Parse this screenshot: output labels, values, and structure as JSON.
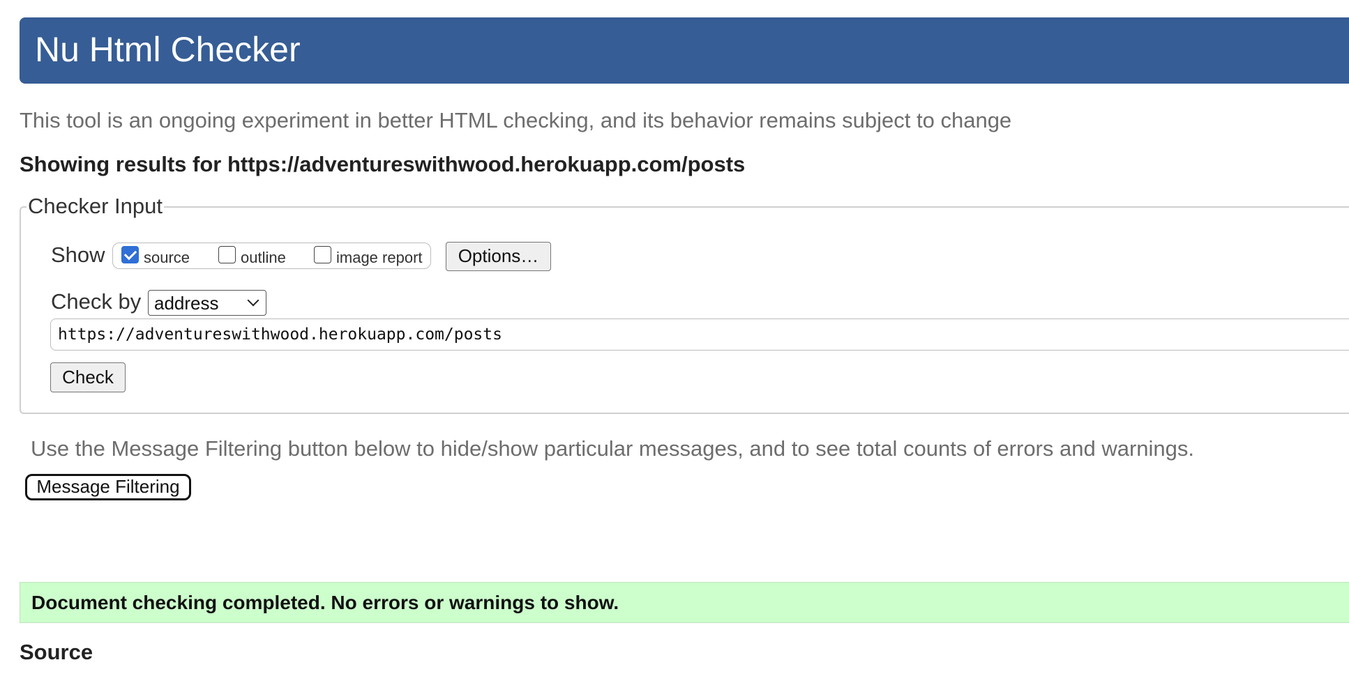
{
  "header": {
    "title": "Nu Html Checker"
  },
  "intro": {
    "tagline": "This tool is an ongoing experiment in better HTML checking, and its behavior remains subject to change",
    "results_heading": "Showing results for https://adventureswithwood.herokuapp.com/posts"
  },
  "checker_input": {
    "legend": "Checker Input",
    "show_label": "Show",
    "show_options": [
      {
        "label": "source",
        "checked": true
      },
      {
        "label": "outline",
        "checked": false
      },
      {
        "label": "image report",
        "checked": false
      }
    ],
    "options_button": "Options…",
    "check_by_label": "Check by",
    "check_by_selected": "address",
    "url_value": "https://adventureswithwood.herokuapp.com/posts",
    "check_button": "Check"
  },
  "filtering": {
    "note": "Use the Message Filtering button below to hide/show particular messages, and to see total counts of errors and warnings.",
    "button": "Message Filtering"
  },
  "result": {
    "message": "Document checking completed. No errors or warnings to show.",
    "source_heading": "Source"
  },
  "colors": {
    "banner": "#365d95",
    "success_bg": "#ccffcc",
    "checkbox_checked": "#2f6fd6",
    "muted_text": "#6d6d6d"
  }
}
